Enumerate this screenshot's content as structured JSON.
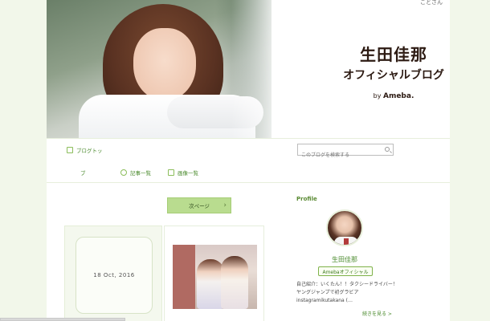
{
  "header": {
    "top_note": "ことさん",
    "title_line1": "生田佳那",
    "title_line2": "オフィシャルブログ",
    "by": "by",
    "brand": "Ameba."
  },
  "nav": {
    "row1": [
      {
        "label": "ブログトッ",
        "icon": "book-icon"
      }
    ],
    "row2": [
      {
        "label": "ブ",
        "icon": ""
      },
      {
        "label": "記事一覧",
        "icon": "pin-icon"
      },
      {
        "label": "画像一覧",
        "icon": "camera-icon"
      }
    ],
    "search_placeholder": "このブログを検索する"
  },
  "main": {
    "next_page": "次ページ",
    "entry_date": "18 Oct, 2016"
  },
  "profile": {
    "heading": "Profile",
    "name": "生田佳那",
    "badge": "Amebaオフィシャル",
    "description": "自己紹介：いくたん！！タクシードライバー！ ヤングジャンプで初グラビア instagramikutakana (…",
    "read_more": "続きを見る >"
  },
  "colors": {
    "accent_green": "#4a8a2c",
    "button_green": "#b9dc8f",
    "band_green": "#f2f7ea"
  }
}
